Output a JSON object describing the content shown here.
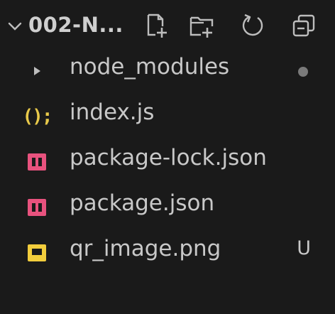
{
  "explorer": {
    "folder_title": "002-N...",
    "actions": {
      "new_file": "new-file-icon",
      "new_folder": "new-folder-icon",
      "refresh": "refresh-icon",
      "collapse_all": "collapse-all-icon"
    }
  },
  "files": [
    {
      "label": "node_modules",
      "icon": "chevron-right-icon",
      "badge": "dot"
    },
    {
      "label": "index.js",
      "icon": "js-icon",
      "icon_text": "();",
      "badge": ""
    },
    {
      "label": "package-lock.json",
      "icon": "json-icon",
      "badge": ""
    },
    {
      "label": "package.json",
      "icon": "json-icon",
      "badge": ""
    },
    {
      "label": "qr_image.png",
      "icon": "image-icon",
      "badge": "U"
    }
  ],
  "colors": {
    "background": "#1a1a1a",
    "text": "#c8c8c8",
    "js_yellow": "#e8c94a",
    "json_pink": "#e8527e",
    "image_yellow": "#f2cd3c"
  }
}
